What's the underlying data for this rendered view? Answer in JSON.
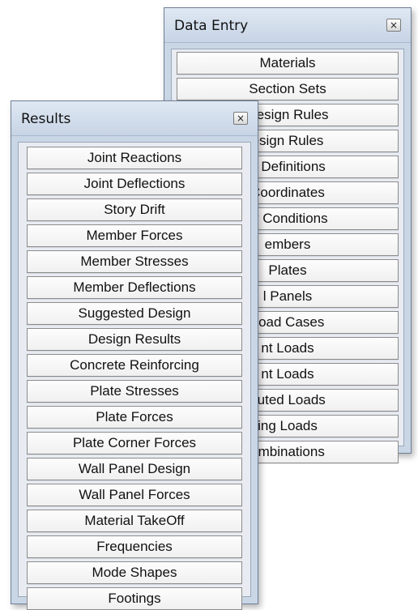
{
  "data_entry": {
    "title": "Data Entry",
    "close_icon": "close-icon",
    "items": [
      "Materials",
      "Section Sets",
      "Design Rules",
      "esign Rules",
      "g Definitions",
      "Coordinates",
      "ry Conditions",
      "embers",
      "Plates",
      "l Panels",
      "Load Cases",
      "nt Loads",
      "nt Loads",
      "buted Loads",
      "ing Loads",
      "ombinations"
    ]
  },
  "results": {
    "title": "Results",
    "close_icon": "close-icon",
    "items": [
      "Joint Reactions",
      "Joint Deflections",
      "Story Drift",
      "Member Forces",
      "Member Stresses",
      "Member Deflections",
      "Suggested Design",
      "Design Results",
      "Concrete Reinforcing",
      "Plate Stresses",
      "Plate Forces",
      "Plate Corner Forces",
      "Wall Panel Design",
      "Wall Panel Forces",
      "Material TakeOff",
      "Frequencies",
      "Mode Shapes",
      "Footings"
    ]
  },
  "colors": {
    "panel_frame": "#c9d6e6",
    "panel_body": "#e8ecf2",
    "button_face": "#f7f7f7",
    "button_border": "#8b8b8b"
  }
}
